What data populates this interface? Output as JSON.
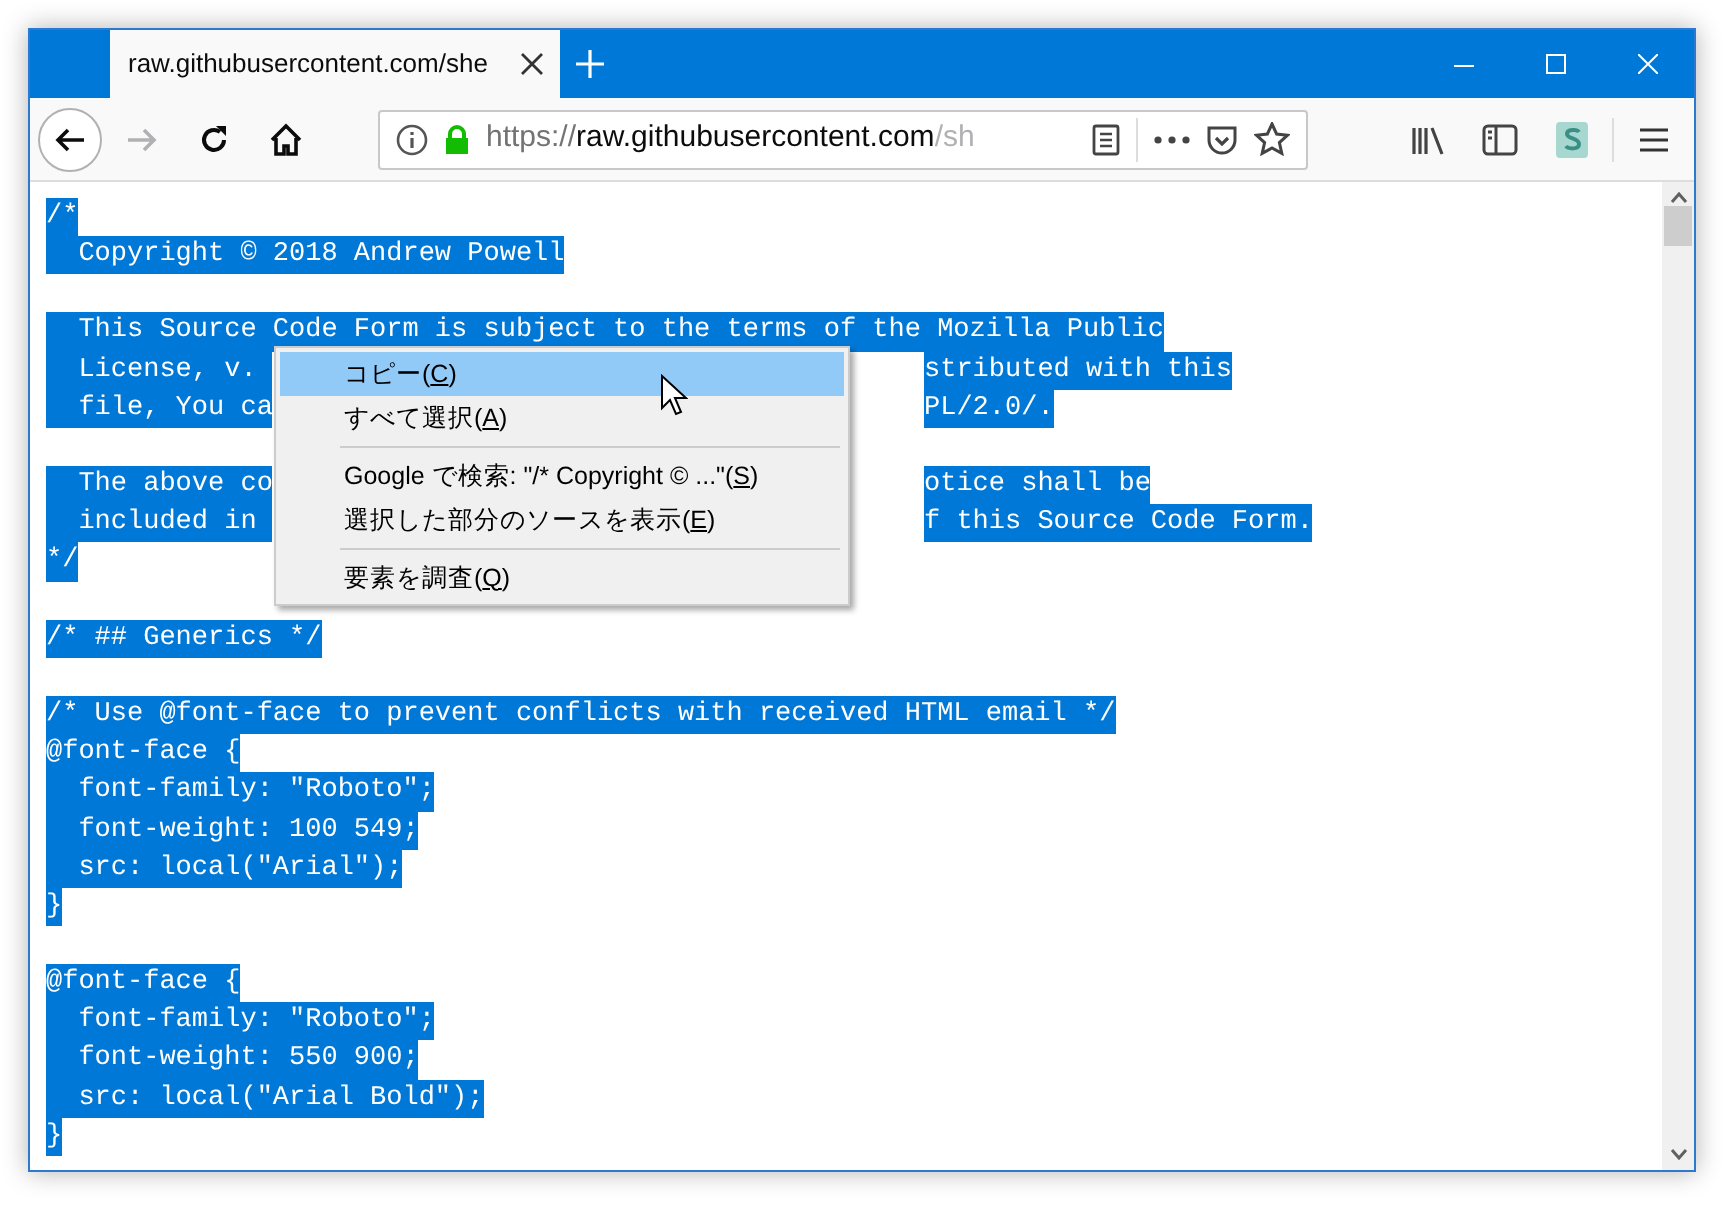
{
  "tabs": [
    {
      "title": "raw.githubusercontent.com/she",
      "selected": true
    }
  ],
  "nav_buttons": [
    {
      "kind": "back",
      "disabled": false
    },
    {
      "kind": "forward",
      "disabled": true
    },
    {
      "kind": "reload",
      "disabled": false
    },
    {
      "kind": "home",
      "disabled": false
    }
  ],
  "address_bar": {
    "scheme": "https://",
    "host": "raw.githubusercontent.com",
    "path": "/sh"
  },
  "code_lines": [
    {
      "kind": "code",
      "selected": true,
      "segments": [
        "/*"
      ]
    },
    {
      "kind": "code",
      "selected": true,
      "segments": [
        "  Copyright © 2018 Andrew Powell"
      ]
    },
    {
      "kind": "blank"
    },
    {
      "kind": "code",
      "selected": true,
      "segments": [
        "  This Source Code Form is subject to the terms of the Mozilla Public"
      ]
    },
    {
      "kind": "code",
      "selected": true,
      "segments": [
        "  License, v. ",
        "stributed with this"
      ]
    },
    {
      "kind": "code",
      "selected": true,
      "segments": [
        "  file, You ca",
        "PL/2.0/."
      ]
    },
    {
      "kind": "blank"
    },
    {
      "kind": "code",
      "selected": true,
      "segments": [
        "  The above co",
        "otice shall be"
      ]
    },
    {
      "kind": "code",
      "selected": true,
      "segments": [
        "  included in ",
        "f this Source Code Form."
      ]
    },
    {
      "kind": "code",
      "selected": true,
      "segments": [
        "*/"
      ]
    },
    {
      "kind": "blank"
    },
    {
      "kind": "code",
      "selected": true,
      "segments": [
        "/* ## Generics */"
      ]
    },
    {
      "kind": "blank"
    },
    {
      "kind": "code",
      "selected": true,
      "segments": [
        "/* Use @font-face to prevent conflicts with received HTML email */"
      ]
    },
    {
      "kind": "code",
      "selected": true,
      "segments": [
        "@font-face {"
      ]
    },
    {
      "kind": "code",
      "selected": true,
      "segments": [
        "  font-family: \"Roboto\";"
      ]
    },
    {
      "kind": "code",
      "selected": true,
      "segments": [
        "  font-weight: 100 549;"
      ]
    },
    {
      "kind": "code",
      "selected": true,
      "segments": [
        "  src: local(\"Arial\");"
      ]
    },
    {
      "kind": "code",
      "selected": true,
      "segments": [
        "}"
      ]
    },
    {
      "kind": "blank"
    },
    {
      "kind": "code",
      "selected": true,
      "segments": [
        "@font-face {"
      ]
    },
    {
      "kind": "code",
      "selected": true,
      "segments": [
        "  font-family: \"Roboto\";"
      ]
    },
    {
      "kind": "code",
      "selected": true,
      "segments": [
        "  font-weight: 550 900;"
      ]
    },
    {
      "kind": "code",
      "selected": true,
      "segments": [
        "  src: local(\"Arial Bold\");"
      ]
    },
    {
      "kind": "code",
      "selected": true,
      "segments": [
        "}"
      ]
    }
  ],
  "context_menu": [
    {
      "kind": "item",
      "selected": true,
      "before": "コピー(",
      "key": "C",
      "after": ")"
    },
    {
      "kind": "item",
      "selected": false,
      "before": "すべて選択(",
      "key": "A",
      "after": ")"
    },
    {
      "kind": "separator"
    },
    {
      "kind": "item",
      "selected": false,
      "before": "Google で検索: \"/* Copyright © ...\"(",
      "key": "S",
      "after": ")"
    },
    {
      "kind": "item",
      "selected": false,
      "before": "選択した部分のソースを表示(",
      "key": "E",
      "after": ")"
    },
    {
      "kind": "separator"
    },
    {
      "kind": "item",
      "selected": false,
      "before": "要素を調査(",
      "key": "Q",
      "after": ")"
    }
  ]
}
